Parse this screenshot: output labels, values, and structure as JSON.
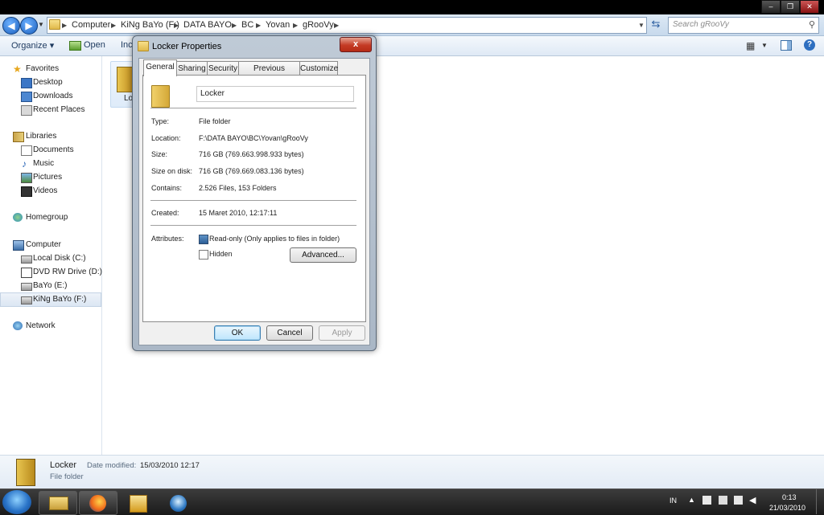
{
  "address": {
    "crumbs": [
      "Computer",
      "KiNg BaYo (F:)",
      "DATA BAYO",
      "BC",
      "Yovan",
      "gRooVy"
    ]
  },
  "search": {
    "placeholder": "Search gRooVy"
  },
  "toolbar": {
    "organize": "Organize ▾",
    "open": "Open",
    "include": "Inc"
  },
  "sidebar": {
    "favorites": {
      "label": "Favorites",
      "items": [
        "Desktop",
        "Downloads",
        "Recent Places"
      ]
    },
    "libraries": {
      "label": "Libraries",
      "items": [
        "Documents",
        "Music",
        "Pictures",
        "Videos"
      ]
    },
    "homegroup": "Homegroup",
    "computer": {
      "label": "Computer",
      "items": [
        "Local Disk (C:)",
        "DVD RW Drive (D:) D",
        "BaYo (E:)",
        "KiNg BaYo (F:)"
      ]
    },
    "network": "Network"
  },
  "content": {
    "item_label": "Lo"
  },
  "details": {
    "name": "Locker",
    "type": "File folder",
    "modified_label": "Date modified:",
    "modified_value": "15/03/2010 12:17"
  },
  "dialog": {
    "title": "Locker Properties",
    "close": "x",
    "tabs": [
      "General",
      "Sharing",
      "Security",
      "Previous Versions",
      "Customize"
    ],
    "name_value": "Locker",
    "rows": [
      {
        "label": "Type:",
        "value": "File folder"
      },
      {
        "label": "Location:",
        "value": "F:\\DATA BAYO\\BC\\Yovan\\gRooVy"
      },
      {
        "label": "Size:",
        "value": "716 GB (769.663.998.933 bytes)"
      },
      {
        "label": "Size on disk:",
        "value": "716 GB (769.669.083.136 bytes)"
      },
      {
        "label": "Contains:",
        "value": "2.526 Files, 153 Folders"
      }
    ],
    "created_label": "Created:",
    "created_value": "15 Maret 2010, 12:17:11",
    "attributes_label": "Attributes:",
    "readonly_label": "Read-only (Only applies to files in folder)",
    "readonly_checked": true,
    "hidden_label": "Hidden",
    "hidden_checked": false,
    "advanced_button": "Advanced...",
    "ok_button": "OK",
    "cancel_button": "Cancel",
    "apply_button": "Apply"
  },
  "tray": {
    "lang": "IN",
    "time": "0:13",
    "date": "21/03/2010"
  },
  "colors": {
    "accent": "#1b5fbd",
    "close_red": "#c43a24",
    "taskbar": "#1a1a1a"
  }
}
